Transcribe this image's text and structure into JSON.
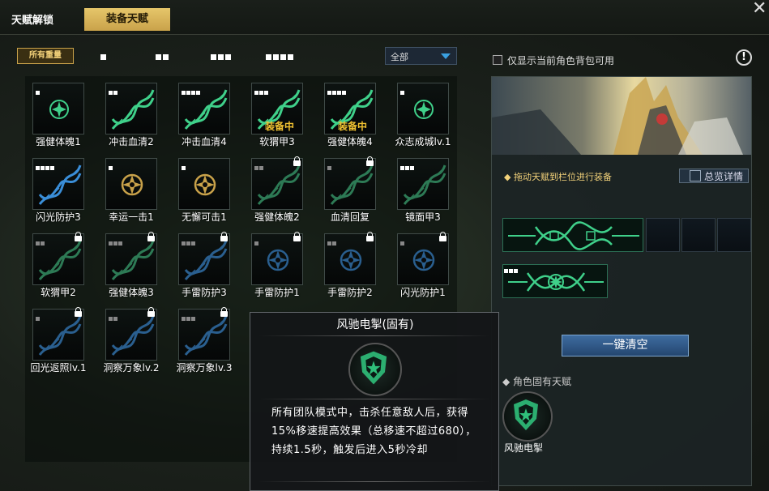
{
  "header": {
    "tab_unlock": "天赋解锁",
    "tab_equip": "装备天赋",
    "close_icon": "close-icon"
  },
  "filters": {
    "all_ranks_label": "所有重量",
    "rank_options": [
      1,
      2,
      3,
      4
    ],
    "dropdown_value": "全部"
  },
  "talents": [
    {
      "label": "强健体魄1",
      "rank": 1,
      "icon": "shield-emblem",
      "tint": "#3fd08a",
      "locked": false,
      "equipped": false
    },
    {
      "label": "冲击血清2",
      "rank": 2,
      "icon": "dna-helix",
      "tint": "#3fd08a",
      "locked": false,
      "equipped": false
    },
    {
      "label": "冲击血清4",
      "rank": 4,
      "icon": "dna-helix",
      "tint": "#3fd08a",
      "locked": false,
      "equipped": false
    },
    {
      "label": "软猬甲3",
      "rank": 3,
      "icon": "dna-helix",
      "tint": "#3fd08a",
      "locked": false,
      "equipped": true
    },
    {
      "label": "强健体魄4",
      "rank": 4,
      "icon": "dna-helix",
      "tint": "#3fd08a",
      "locked": false,
      "equipped": true
    },
    {
      "label": "众志成城lv.1",
      "rank": 1,
      "icon": "shield-emblem",
      "tint": "#3fd08a",
      "locked": false,
      "equipped": false
    },
    {
      "label": "闪光防护3",
      "rank": 4,
      "icon": "dna-helix",
      "tint": "#3a8ed8",
      "locked": false,
      "equipped": false
    },
    {
      "label": "幸运一击1",
      "rank": 1,
      "icon": "compass-emblem",
      "tint": "#c9a24a",
      "locked": false,
      "equipped": false
    },
    {
      "label": "无懈可击1",
      "rank": 1,
      "icon": "compass-emblem",
      "tint": "#c9a24a",
      "locked": false,
      "equipped": false
    },
    {
      "label": "强健体魄2",
      "rank": 2,
      "icon": "dna-helix",
      "tint": "#2d7a55",
      "locked": true,
      "equipped": false
    },
    {
      "label": "血清回复",
      "rank": 1,
      "icon": "dna-helix",
      "tint": "#2d7a55",
      "locked": true,
      "equipped": false
    },
    {
      "label": "镜面甲3",
      "rank": 3,
      "icon": "dna-helix",
      "tint": "#2d7a55",
      "locked": false,
      "equipped": false
    },
    {
      "label": "软猬甲2",
      "rank": 2,
      "icon": "dna-helix",
      "tint": "#2d7a55",
      "locked": true,
      "equipped": false
    },
    {
      "label": "强健体魄3",
      "rank": 3,
      "icon": "dna-helix",
      "tint": "#2d7a55",
      "locked": true,
      "equipped": false
    },
    {
      "label": "手雷防护3",
      "rank": 3,
      "icon": "dna-helix",
      "tint": "#2a5f8f",
      "locked": true,
      "equipped": false
    },
    {
      "label": "手雷防护1",
      "rank": 1,
      "icon": "compass-emblem",
      "tint": "#2a5f8f",
      "locked": true,
      "equipped": false
    },
    {
      "label": "手雷防护2",
      "rank": 2,
      "icon": "compass-emblem",
      "tint": "#2a5f8f",
      "locked": true,
      "equipped": false
    },
    {
      "label": "闪光防护1",
      "rank": 1,
      "icon": "compass-emblem",
      "tint": "#2a5f8f",
      "locked": true,
      "equipped": false
    },
    {
      "label": "回光返照lv.1",
      "rank": 1,
      "icon": "dna-helix",
      "tint": "#2a5f8f",
      "locked": true,
      "equipped": false
    },
    {
      "label": "洞察万象lv.2",
      "rank": 2,
      "icon": "dna-helix",
      "tint": "#2a5f8f",
      "locked": true,
      "equipped": false
    },
    {
      "label": "洞察万象lv.3",
      "rank": 3,
      "icon": "dna-helix",
      "tint": "#2a5f8f",
      "locked": true,
      "equipped": false
    }
  ],
  "equipped_text": "装备中",
  "right": {
    "only_show_label": "仅显示当前角色背包可用",
    "info_icon": "!",
    "drag_tip": "拖动天赋到栏位进行装备",
    "overview_label": "总览详情",
    "slot_row1_rank": 3,
    "slot_row2_rank": 3,
    "clear_label": "一键清空",
    "innate_title": "角色固有天赋",
    "innate_label": "风驰电掣"
  },
  "tooltip": {
    "title": "风驰电掣(固有)",
    "description": "所有团队模式中，击杀任意敌人后，获得15%移速提高效果（总移速不超过680），持续1.5秒，触发后进入5秒冷却"
  },
  "colors": {
    "accent_gold": "#c9a24a",
    "green": "#3fd08a",
    "blue": "#3a8ed8",
    "equipped": "#f1c232"
  }
}
